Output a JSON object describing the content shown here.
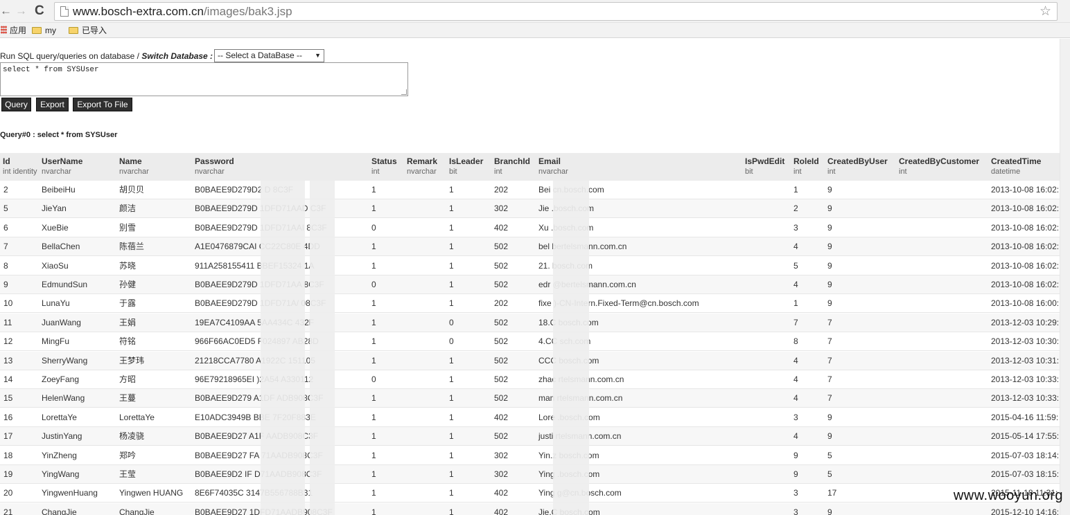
{
  "browser": {
    "url_host": "www.bosch-extra.com.cn",
    "url_path": "/images/bak3.jsp",
    "bookmarks": [
      "应用",
      "my",
      "已导入"
    ]
  },
  "form": {
    "label_prefix": "Run SQL query/queries on database / ",
    "label_switch": "Switch Database :",
    "db_select_value": "-- Select a DataBase --",
    "sql_text": "select * from SYSUser",
    "buttons": [
      "Query",
      "Export",
      "Export To File"
    ]
  },
  "result_title": "Query#0 : select * from SYSUser",
  "table": {
    "columns": [
      {
        "name": "Id",
        "type": "int identity"
      },
      {
        "name": "UserName",
        "type": "nvarchar"
      },
      {
        "name": "Name",
        "type": "nvarchar"
      },
      {
        "name": "Password",
        "type": "nvarchar"
      },
      {
        "name": "Status",
        "type": "int"
      },
      {
        "name": "Remark",
        "type": "nvarchar"
      },
      {
        "name": "IsLeader",
        "type": "bit"
      },
      {
        "name": "BranchId",
        "type": "int"
      },
      {
        "name": "Email",
        "type": "nvarchar"
      },
      {
        "name": "IsPwdEdit",
        "type": "bit"
      },
      {
        "name": "RoleId",
        "type": "int"
      },
      {
        "name": "CreatedByUser",
        "type": "int"
      },
      {
        "name": "CreatedByCustomer",
        "type": "int"
      },
      {
        "name": "CreatedTime",
        "type": "datetime"
      }
    ],
    "rows": [
      [
        "2",
        "BeibeiHu",
        "胡贝贝",
        "B0BAEE9D279D2        D              8C3F",
        "1",
        "",
        "1",
        "202",
        "Bei          cn.bosch.com",
        "",
        "1",
        "9",
        "",
        "2013-10-08 16:02:"
      ],
      [
        "5",
        "JieYan",
        "颜洁",
        "B0BAEE9D279D        1DFD71AAD       C3F",
        "1",
        "",
        "1",
        "302",
        "Jie            .bosch.com",
        "",
        "2",
        "9",
        "",
        "2013-10-08 16:02:"
      ],
      [
        "6",
        "XueBie",
        "别雪",
        "B0BAEE9D279D        1DFD71AAI       8C3F",
        "0",
        "",
        "1",
        "402",
        "Xu             .bosch.com",
        "",
        "3",
        "9",
        "",
        "2013-10-08 16:02:"
      ],
      [
        "7",
        "BellaChen",
        "陈蓓兰",
        "A1E0476879CAI       CC22C80E       4DD",
        "1",
        "",
        "1",
        "502",
        "bel            bertelsmann.com.cn",
        "",
        "4",
        "9",
        "",
        "2013-10-08 16:02:"
      ],
      [
        "8",
        "XiaoSu",
        "苏晓",
        "911A258155411       BBEF15324      1A",
        "1",
        "",
        "1",
        "502",
        "21.            bosch.com",
        "",
        "5",
        "9",
        "",
        "2013-10-08 16:02:"
      ],
      [
        "9",
        "EdmundSun",
        "孙健",
        "B0BAEE9D279D        1DFD71AA        8C3F",
        "0",
        "",
        "1",
        "502",
        "edr            @bertelsmann.com.cn",
        "",
        "4",
        "9",
        "",
        "2013-10-08 16:02:"
      ],
      [
        "10",
        "LunaYu",
        "于露",
        "B0BAEE9D279D        1DFD71A/       08C3F",
        "1",
        "",
        "1",
        "202",
        "fixe           )-CN-Intern.Fixed-Term@cn.bosch.com",
        "",
        "1",
        "9",
        "",
        "2013-10-08 16:00:"
      ],
      [
        "11",
        "JuanWang",
        "王娟",
        "19EA7C4109AA        5AA434C        432F",
        "1",
        "",
        "0",
        "502",
        "18.C           bosch.com",
        "",
        "7",
        "7",
        "",
        "2013-12-03 10:29:"
      ],
      [
        "12",
        "MingFu",
        "符铭",
        "966F66AC0ED5        F024897        AB28D",
        "1",
        "",
        "0",
        "502",
        "4.CC           sch.com",
        "",
        "8",
        "7",
        "",
        "2013-12-03 10:30:"
      ],
      [
        "13",
        "SherryWang",
        "王梦玮",
        "21218CCA7780        A1922C         151105",
        "1",
        "",
        "1",
        "502",
        "CCC            bosch.com",
        "",
        "4",
        "7",
        "",
        "2013-12-03 10:31:"
      ],
      [
        "14",
        "ZoeyFang",
        "方昭",
        "96E79218965EI       )2A54          A330112",
        "0",
        "",
        "1",
        "502",
        "zhac           rtelsmann.com.cn",
        "",
        "4",
        "7",
        "",
        "2013-12-03 10:33:"
      ],
      [
        "15",
        "HelenWang",
        "王蔓",
        "B0BAEE9D279        A1DF           ADB908C3F",
        "1",
        "",
        "1",
        "502",
        "man            rtelsmann.com.cn",
        "",
        "4",
        "7",
        "",
        "2013-12-03 10:33:"
      ],
      [
        "16",
        "LorettaYe",
        "LorettaYe",
        "E10ADC3949B        BBE            7F20F883E",
        "1",
        "",
        "1",
        "402",
        "Lore           .bosch.com",
        "",
        "3",
        "9",
        "",
        "2015-04-16 11:59:"
      ],
      [
        "17",
        "JustinYang",
        "杨凌骁",
        "B0BAEE9D27         A1F            AADB908C3F",
        "1",
        "",
        "1",
        "502",
        "justi          rtelsmann.com.cn",
        "",
        "4",
        "9",
        "",
        "2015-05-14 17:55:"
      ],
      [
        "18",
        "YinZheng",
        "郑吟",
        "B0BAEE9D27         FA             71AADB908C3F",
        "1",
        "",
        "1",
        "302",
        "Yin.z          bosch.com",
        "",
        "9",
        "5",
        "",
        "2015-07-03 18:14:"
      ],
      [
        "19",
        "YingWang",
        "王莹",
        "B0BAEE9D2          IF             D71AADB908C3F",
        "1",
        "",
        "1",
        "302",
        "Ying           .bosch.com",
        "",
        "9",
        "5",
        "",
        "2015-07-03 18:15:"
      ],
      [
        "20",
        "YingwenHuang",
        "Yingwen HUANG",
        "8E6F74035C                    3147B556788B31",
        "1",
        "",
        "1",
        "402",
        "Ying           g@cn.bosch.com",
        "",
        "3",
        "17",
        "",
        "2015-11-18 11:31:"
      ],
      [
        "21",
        "ChangJie",
        "ChangJie",
        "B0BAEE9D27         1DFD71AADB908C3F",
        "1",
        "",
        "1",
        "402",
        "Jie.C          bosch.com",
        "",
        "3",
        "9",
        "",
        "2015-12-10 14:16:"
      ]
    ]
  },
  "watermark": "www.wooyun.org"
}
